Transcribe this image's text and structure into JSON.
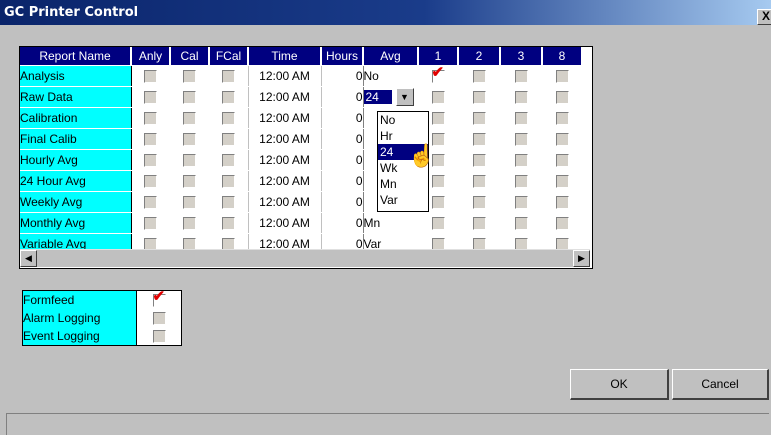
{
  "window": {
    "title": "GC Printer Control",
    "close_label": "X"
  },
  "grid": {
    "columns": [
      "Report Name",
      "Anly",
      "Cal",
      "FCal",
      "Time",
      "Hours",
      "Avg",
      "1",
      "2",
      "3",
      "8"
    ],
    "rows": [
      {
        "name": "Analysis",
        "anly": false,
        "cal": false,
        "fcal": false,
        "time": "12:00 AM",
        "hours": "0",
        "avg": "No",
        "c1": true,
        "c2": false,
        "c3": false,
        "c8": false
      },
      {
        "name": "Raw Data",
        "anly": false,
        "cal": false,
        "fcal": false,
        "time": "12:00 AM",
        "hours": "0",
        "avg": "24",
        "c1": false,
        "c2": false,
        "c3": false,
        "c8": false
      },
      {
        "name": "Calibration",
        "anly": false,
        "cal": false,
        "fcal": false,
        "time": "12:00 AM",
        "hours": "0",
        "avg": "",
        "c1": false,
        "c2": false,
        "c3": false,
        "c8": false
      },
      {
        "name": "Final Calib",
        "anly": false,
        "cal": false,
        "fcal": false,
        "time": "12:00 AM",
        "hours": "0",
        "avg": "",
        "c1": false,
        "c2": false,
        "c3": false,
        "c8": false
      },
      {
        "name": "Hourly Avg",
        "anly": false,
        "cal": false,
        "fcal": false,
        "time": "12:00 AM",
        "hours": "0",
        "avg": "",
        "c1": false,
        "c2": false,
        "c3": false,
        "c8": false
      },
      {
        "name": "24 Hour Avg",
        "anly": false,
        "cal": false,
        "fcal": false,
        "time": "12:00 AM",
        "hours": "0",
        "avg": "",
        "c1": false,
        "c2": false,
        "c3": false,
        "c8": false
      },
      {
        "name": "Weekly Avg",
        "anly": false,
        "cal": false,
        "fcal": false,
        "time": "12:00 AM",
        "hours": "0",
        "avg": "",
        "c1": false,
        "c2": false,
        "c3": false,
        "c8": false
      },
      {
        "name": "Monthly Avg",
        "anly": false,
        "cal": false,
        "fcal": false,
        "time": "12:00 AM",
        "hours": "0",
        "avg": "Mn",
        "c1": false,
        "c2": false,
        "c3": false,
        "c8": false
      },
      {
        "name": "Variable Avg",
        "anly": false,
        "cal": false,
        "fcal": false,
        "time": "12:00 AM",
        "hours": "0",
        "avg": "Var",
        "c1": false,
        "c2": false,
        "c3": false,
        "c8": false
      }
    ],
    "avg_dropdown": {
      "options": [
        "No",
        "Hr",
        "24",
        "Wk",
        "Mn",
        "Var"
      ],
      "selected": "24"
    }
  },
  "options": [
    {
      "label": "Formfeed",
      "checked": true
    },
    {
      "label": "Alarm Logging",
      "checked": false
    },
    {
      "label": "Event Logging",
      "checked": false
    }
  ],
  "buttons": {
    "ok": "OK",
    "cancel": "Cancel"
  },
  "colors": {
    "title_bar": "#0a246a",
    "header_bg": "#000080",
    "name_cell_bg": "#00ffff",
    "check_mark": "#e00000"
  }
}
